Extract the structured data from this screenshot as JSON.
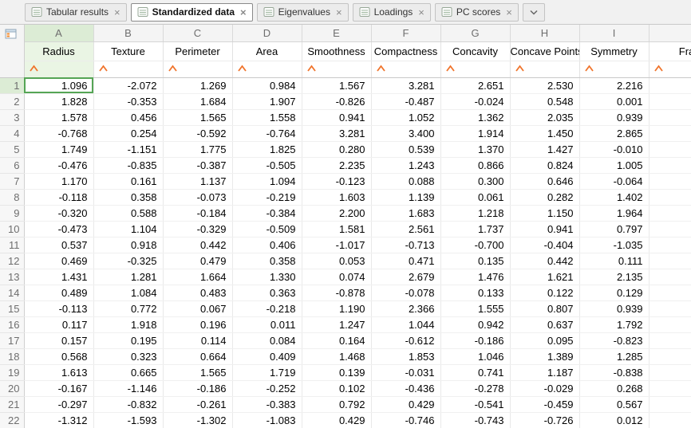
{
  "colors": {
    "selection_green": "#55a555",
    "selected_header_tint": "#dcecd5",
    "selected_soft_tint": "#eaf5e4",
    "caret_orange": "#f0742c"
  },
  "tab_bar": {
    "close_glyph": "×",
    "tabs": [
      {
        "label": "Tabular results",
        "active": false
      },
      {
        "label": "Standardized data",
        "active": true
      },
      {
        "label": "Eigenvalues",
        "active": false
      },
      {
        "label": "Loadings",
        "active": false
      },
      {
        "label": "PC scores",
        "active": false
      }
    ]
  },
  "grid": {
    "column_letters": [
      "A",
      "B",
      "C",
      "D",
      "E",
      "F",
      "G",
      "H",
      "I"
    ],
    "columns": [
      "Radius",
      "Texture",
      "Perimeter",
      "Area",
      "Smoothness",
      "Compactness",
      "Concavity",
      "Concave Points",
      "Symmetry"
    ],
    "partial_column_label": "Fra",
    "selection": {
      "row": "1",
      "column": "A"
    },
    "rows": [
      {
        "n": "1",
        "values": [
          "1.096",
          "-2.072",
          "1.269",
          "0.984",
          "1.567",
          "3.281",
          "2.651",
          "2.530",
          "2.216"
        ]
      },
      {
        "n": "2",
        "values": [
          "1.828",
          "-0.353",
          "1.684",
          "1.907",
          "-0.826",
          "-0.487",
          "-0.024",
          "0.548",
          "0.001"
        ]
      },
      {
        "n": "3",
        "values": [
          "1.578",
          "0.456",
          "1.565",
          "1.558",
          "0.941",
          "1.052",
          "1.362",
          "2.035",
          "0.939"
        ]
      },
      {
        "n": "4",
        "values": [
          "-0.768",
          "0.254",
          "-0.592",
          "-0.764",
          "3.281",
          "3.400",
          "1.914",
          "1.450",
          "2.865"
        ]
      },
      {
        "n": "5",
        "values": [
          "1.749",
          "-1.151",
          "1.775",
          "1.825",
          "0.280",
          "0.539",
          "1.370",
          "1.427",
          "-0.010"
        ]
      },
      {
        "n": "6",
        "values": [
          "-0.476",
          "-0.835",
          "-0.387",
          "-0.505",
          "2.235",
          "1.243",
          "0.866",
          "0.824",
          "1.005"
        ]
      },
      {
        "n": "7",
        "values": [
          "1.170",
          "0.161",
          "1.137",
          "1.094",
          "-0.123",
          "0.088",
          "0.300",
          "0.646",
          "-0.064"
        ]
      },
      {
        "n": "8",
        "values": [
          "-0.118",
          "0.358",
          "-0.073",
          "-0.219",
          "1.603",
          "1.139",
          "0.061",
          "0.282",
          "1.402"
        ]
      },
      {
        "n": "9",
        "values": [
          "-0.320",
          "0.588",
          "-0.184",
          "-0.384",
          "2.200",
          "1.683",
          "1.218",
          "1.150",
          "1.964"
        ]
      },
      {
        "n": "10",
        "values": [
          "-0.473",
          "1.104",
          "-0.329",
          "-0.509",
          "1.581",
          "2.561",
          "1.737",
          "0.941",
          "0.797"
        ]
      },
      {
        "n": "11",
        "values": [
          "0.537",
          "0.918",
          "0.442",
          "0.406",
          "-1.017",
          "-0.713",
          "-0.700",
          "-0.404",
          "-1.035"
        ]
      },
      {
        "n": "12",
        "values": [
          "0.469",
          "-0.325",
          "0.479",
          "0.358",
          "0.053",
          "0.471",
          "0.135",
          "0.442",
          "0.111"
        ]
      },
      {
        "n": "13",
        "values": [
          "1.431",
          "1.281",
          "1.664",
          "1.330",
          "0.074",
          "2.679",
          "1.476",
          "1.621",
          "2.135"
        ]
      },
      {
        "n": "14",
        "values": [
          "0.489",
          "1.084",
          "0.483",
          "0.363",
          "-0.878",
          "-0.078",
          "0.133",
          "0.122",
          "0.129"
        ]
      },
      {
        "n": "15",
        "values": [
          "-0.113",
          "0.772",
          "0.067",
          "-0.218",
          "1.190",
          "2.366",
          "1.555",
          "0.807",
          "0.939"
        ]
      },
      {
        "n": "16",
        "values": [
          "0.117",
          "1.918",
          "0.196",
          "0.011",
          "1.247",
          "1.044",
          "0.942",
          "0.637",
          "1.792"
        ]
      },
      {
        "n": "17",
        "values": [
          "0.157",
          "0.195",
          "0.114",
          "0.084",
          "0.164",
          "-0.612",
          "-0.186",
          "0.095",
          "-0.823"
        ]
      },
      {
        "n": "18",
        "values": [
          "0.568",
          "0.323",
          "0.664",
          "0.409",
          "1.468",
          "1.853",
          "1.046",
          "1.389",
          "1.285"
        ]
      },
      {
        "n": "19",
        "values": [
          "1.613",
          "0.665",
          "1.565",
          "1.719",
          "0.139",
          "-0.031",
          "0.741",
          "1.187",
          "-0.838"
        ]
      },
      {
        "n": "20",
        "values": [
          "-0.167",
          "-1.146",
          "-0.186",
          "-0.252",
          "0.102",
          "-0.436",
          "-0.278",
          "-0.029",
          "0.268"
        ]
      },
      {
        "n": "21",
        "values": [
          "-0.297",
          "-0.832",
          "-0.261",
          "-0.383",
          "0.792",
          "0.429",
          "-0.541",
          "-0.459",
          "0.567"
        ]
      },
      {
        "n": "22",
        "values": [
          "-1.312",
          "-1.593",
          "-1.302",
          "-1.083",
          "0.429",
          "-0.746",
          "-0.743",
          "-0.726",
          "0.012"
        ]
      }
    ]
  }
}
